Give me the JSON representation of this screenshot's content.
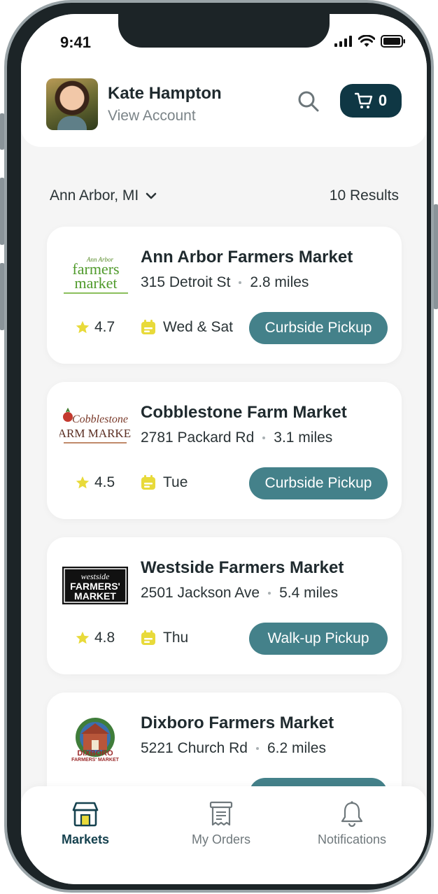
{
  "status_bar": {
    "time": "9:41"
  },
  "header": {
    "user_name": "Kate Hampton",
    "account_link": "View Account",
    "cart_count": "0",
    "search_icon": "search-icon",
    "cart_icon": "cart-icon"
  },
  "location": {
    "city": "Ann Arbor, MI",
    "results": "10 Results"
  },
  "colors": {
    "primary_dark": "#0f3744",
    "pickup_button": "#44818a",
    "star": "#e8da3a",
    "calendar": "#e8da3a",
    "active_tab": "#16424f"
  },
  "markets": [
    {
      "name": "Ann Arbor Farmers Market",
      "address": "315 Detroit St",
      "distance": "2.8 miles",
      "rating": "4.7",
      "days": "Wed & Sat",
      "pickup": "Curbside Pickup",
      "logo_text": [
        "Ann Arbor",
        "farmers",
        "market"
      ]
    },
    {
      "name": "Cobblestone Farm Market",
      "address": "2781 Packard Rd",
      "distance": "3.1 miles",
      "rating": "4.5",
      "days": "Tue",
      "pickup": "Curbside Pickup",
      "logo_text": [
        "Cobblestone",
        "FARM MARKET"
      ]
    },
    {
      "name": "Westside Farmers Market",
      "address": "2501 Jackson Ave",
      "distance": "5.4 miles",
      "rating": "4.8",
      "days": "Thu",
      "pickup": "Walk-up Pickup",
      "logo_text": [
        "westside",
        "FARMERS'",
        "MARKET"
      ]
    },
    {
      "name": "Dixboro Farmers Market",
      "address": "5221 Church Rd",
      "distance": "6.2 miles",
      "rating": "",
      "days": "",
      "pickup": "",
      "logo_text": [
        "DIXBORO",
        "FARMERS' MARKET"
      ]
    }
  ],
  "tabs": [
    {
      "label": "Markets",
      "icon": "storefront-icon",
      "active": true
    },
    {
      "label": "My Orders",
      "icon": "receipt-icon",
      "active": false
    },
    {
      "label": "Notifications",
      "icon": "bell-icon",
      "active": false
    }
  ]
}
